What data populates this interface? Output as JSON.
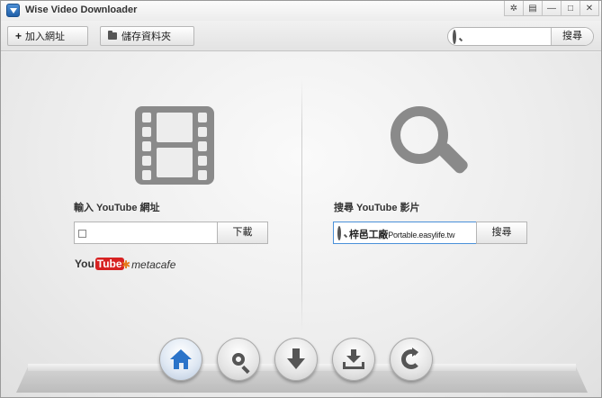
{
  "window": {
    "title": "Wise Video Downloader",
    "controls": [
      "gear-icon",
      "menu-icon",
      "minimize-icon",
      "maximize-icon",
      "close-icon"
    ],
    "control_glyphs": [
      "✲",
      "▤",
      "—",
      "□",
      "✕"
    ]
  },
  "toolbar": {
    "add_url_label": "加入網址",
    "add_url_glyph": "+",
    "save_folder_label": "儲存資料夾",
    "search_value": "",
    "search_button_label": "搜尋"
  },
  "left_panel": {
    "label": "輸入 YouTube 網址",
    "url_value": "",
    "download_button_label": "下載",
    "logos": {
      "youtube_you": "You",
      "youtube_tube": "Tube",
      "metacafe": "metacafe"
    }
  },
  "right_panel": {
    "label": "搜尋 YouTube 影片",
    "search_text_main": "梓邑工廠",
    "search_text_small": "Portable.easylife.tw",
    "search_button_label": "搜尋"
  },
  "nav": {
    "items": [
      {
        "icon": "home-icon",
        "active": true
      },
      {
        "icon": "search-icon",
        "active": false
      },
      {
        "icon": "download-icon",
        "active": false
      },
      {
        "icon": "downloaded-icon",
        "active": false
      },
      {
        "icon": "convert-icon",
        "active": false
      }
    ]
  },
  "colors": {
    "accent": "#2a73c9",
    "icon_gray": "#8a8a8a",
    "youtube_red": "#d72222",
    "metacafe_orange": "#e47a1c",
    "focus_border": "#4a90d9"
  }
}
